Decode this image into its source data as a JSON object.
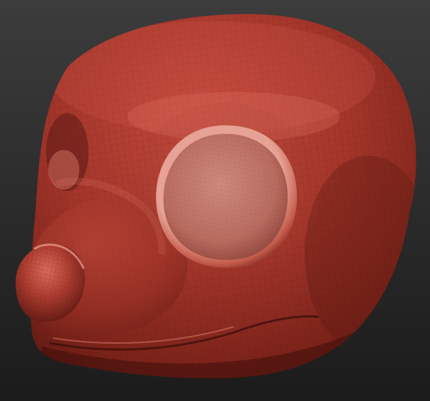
{
  "viewport": {
    "background_top": "#3a3a3a",
    "background_bottom": "#1c1c1c",
    "model_base_color": "#a3352a",
    "model_highlight_color": "#e08a7a",
    "model_shadow_color": "#4a1410",
    "wireframe_color": "#5a1a14"
  }
}
